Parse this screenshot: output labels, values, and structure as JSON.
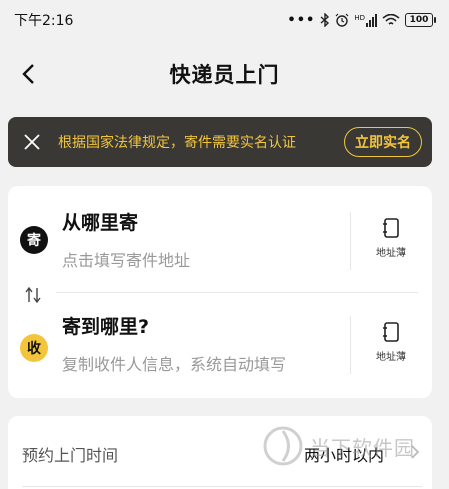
{
  "status_bar": {
    "time": "下午2:16",
    "signal_text": "HD",
    "battery": "100"
  },
  "nav": {
    "title": "快递员上门"
  },
  "notice": {
    "text": "根据国家法律规定，寄件需要实名认证",
    "button_label": "立即实名",
    "accent_color": "#f2c53d"
  },
  "sender": {
    "badge": "寄",
    "title": "从哪里寄",
    "hint": "点击填写寄件地址",
    "book_label": "地址薄"
  },
  "receiver": {
    "badge": "收",
    "title": "寄到哪里?",
    "hint": "复制收件人信息，系统自动填写",
    "book_label": "地址薄"
  },
  "pickup_time": {
    "label": "预约上门时间",
    "value": "两小时以内"
  },
  "watermark": {
    "text": "当下软件园"
  }
}
